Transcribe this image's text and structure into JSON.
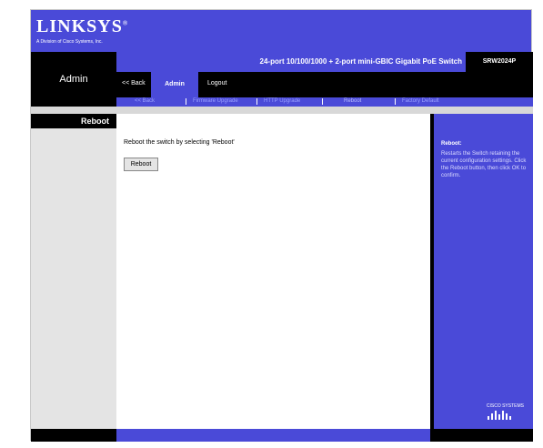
{
  "brand": {
    "logo_text": "LINKSYS",
    "logo_sub": "A Division of Cisco Systems, Inc.",
    "footer_brand": "CISCO SYSTEMS"
  },
  "product": {
    "name": "24-port 10/100/1000 + 2-port mini-GBIC Gigabit PoE Switch",
    "model": "SRW2024P"
  },
  "left_panel": {
    "section": "Admin"
  },
  "nav": {
    "back": "<< Back",
    "admin": "Admin",
    "logout": "Logout"
  },
  "subnav": {
    "items": [
      "<< Back",
      "Firmware Upgrade",
      "HTTP Upgrade",
      "Reboot",
      "Factory Default"
    ]
  },
  "sidebar": {
    "title": "Reboot"
  },
  "content": {
    "instruction": "Reboot the switch by selecting 'Reboot'",
    "button": "Reboot"
  },
  "help": {
    "title": "Reboot:",
    "text": "Restarts the Switch retaining the current configuration settings. Click the Reboot button, then click OK to confirm."
  },
  "colors": {
    "blue": "#4a4ad8",
    "black": "#000000"
  }
}
